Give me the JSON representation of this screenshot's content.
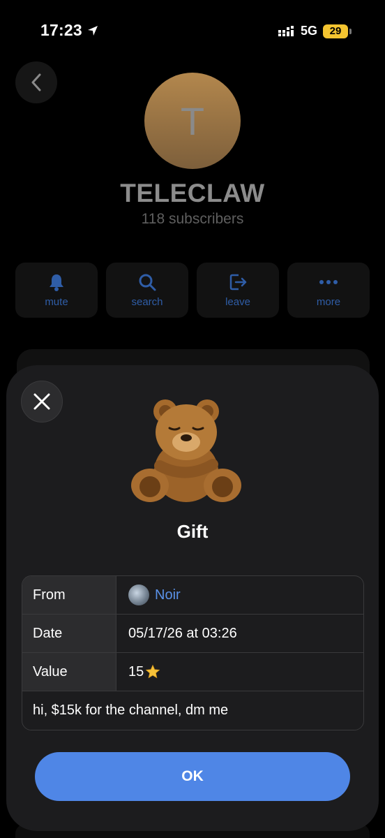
{
  "status_bar": {
    "time": "17:23",
    "network": "5G",
    "battery": "29"
  },
  "channel": {
    "initial": "T",
    "name": "TELECLAW",
    "subscribers": "118 subscribers"
  },
  "actions": [
    {
      "label": "mute",
      "icon": "bell-icon"
    },
    {
      "label": "search",
      "icon": "search-icon"
    },
    {
      "label": "leave",
      "icon": "leave-icon"
    },
    {
      "label": "more",
      "icon": "more-icon"
    }
  ],
  "gift": {
    "title": "Gift",
    "rows": {
      "from_label": "From",
      "from_value": "Noir",
      "date_label": "Date",
      "date_value": "05/17/26 at 03:26",
      "value_label": "Value",
      "value_value": "15"
    },
    "message": "hi, $15k for the channel, dm me",
    "ok_label": "OK"
  },
  "colors": {
    "accent": "#4f86e6",
    "link": "#5a91e8",
    "sheet_bg": "#1c1c1e"
  }
}
